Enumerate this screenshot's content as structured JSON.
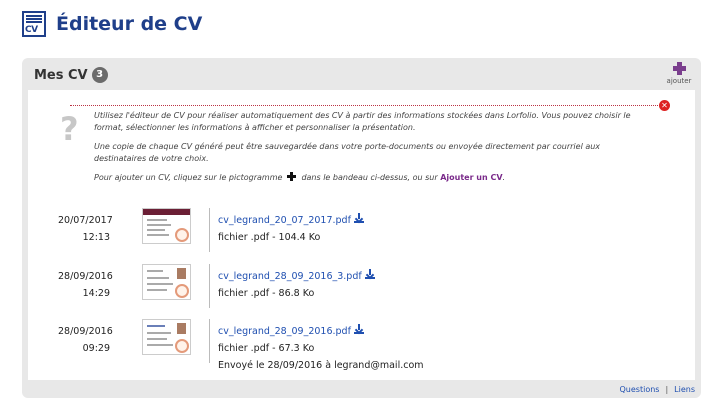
{
  "app": {
    "title": "Éditeur de CV",
    "logo_text": "CV"
  },
  "panel": {
    "title": "Mes CV",
    "count": "3",
    "add_label": "ajouter"
  },
  "help": {
    "paragraph1": "Utilisez l'éditeur de CV pour réaliser automatiquement des CV à partir des informations stockées dans Lorfolio. Vous pouvez choisir le format, sélectionner les informations à afficher et personnaliser la présentation.",
    "paragraph2": "Une copie de chaque CV généré peut être sauvegardée dans votre porte-documents ou envoyée directement par courriel aux destinataires de votre choix.",
    "paragraph3_before": "Pour ajouter un CV, cliquez sur le pictogramme",
    "paragraph3_middle": "dans le bandeau ci-dessus, ou sur",
    "paragraph3_link": "Ajouter un CV",
    "paragraph3_after": "."
  },
  "cvs": [
    {
      "date": "20/07/2017",
      "time": "12:13",
      "filename": "cv_legrand_20_07_2017.pdf",
      "info": "fichier .pdf - 104.4 Ko",
      "sent": ""
    },
    {
      "date": "28/09/2016",
      "time": "14:29",
      "filename": "cv_legrand_28_09_2016_3.pdf",
      "info": "fichier .pdf - 86.8 Ko",
      "sent": ""
    },
    {
      "date": "28/09/2016",
      "time": "09:29",
      "filename": "cv_legrand_28_09_2016.pdf",
      "info": "fichier .pdf - 67.3 Ko",
      "sent": "Envoyé le 28/09/2016 à legrand@mail.com"
    }
  ],
  "footer": {
    "questions": "Questions",
    "separator": "|",
    "links": "Liens"
  },
  "icons": {
    "logo": "cv-logo-icon",
    "add": "plus-icon",
    "help": "question-mark-icon",
    "close": "close-icon",
    "download": "download-icon"
  },
  "colors": {
    "brand": "#1f3f8a",
    "accent": "#7a3e8d",
    "link": "#1f4fb0",
    "close": "#dd2222"
  }
}
